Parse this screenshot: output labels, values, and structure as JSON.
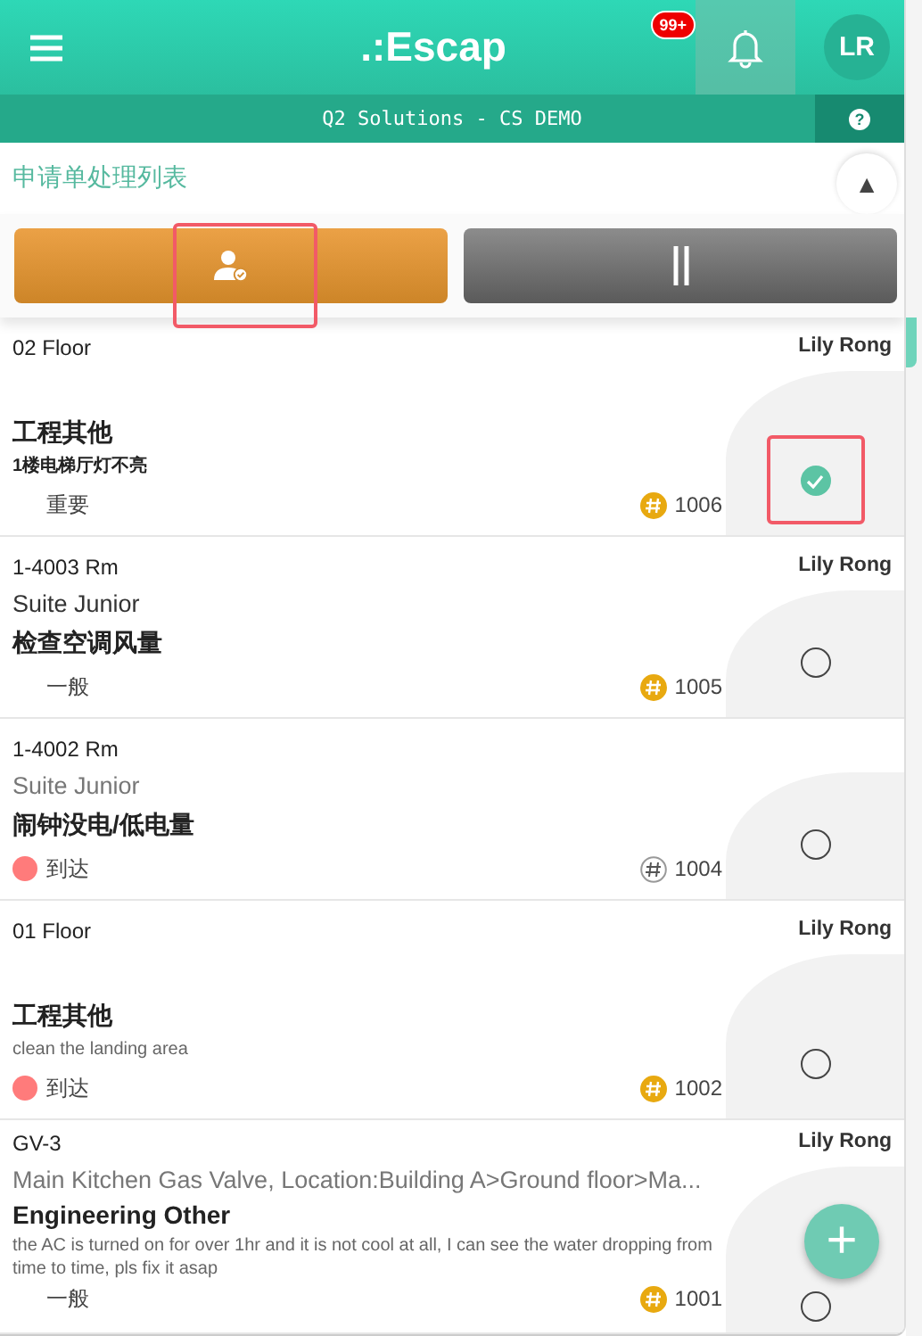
{
  "header": {
    "logo": ".:Escap",
    "badge": "99+",
    "avatar": "LR"
  },
  "subheader": {
    "title": "Q2 Solutions - CS DEMO",
    "help": "?"
  },
  "page_title": "申请单处理列表",
  "collapse": "▲",
  "actions": [
    {
      "kind": "assign",
      "highlighted": true
    },
    {
      "kind": "pause",
      "highlighted": false
    }
  ],
  "rows": [
    {
      "location": "02 Floor",
      "assignee": "Lily Rong",
      "title": "工程其他",
      "description": "1楼电梯厅灯不亮",
      "description_bold": true,
      "status": "重要",
      "number": "1006",
      "number_outlined": false,
      "checked": true,
      "highlighted": true
    },
    {
      "location": "1-4003 Rm",
      "assignee": "Lily Rong",
      "subtitle": "Suite Junior",
      "subtitle_muted": false,
      "title": "检查空调风量",
      "status": "一般",
      "number": "1005",
      "number_outlined": false,
      "checked": false,
      "highlighted": false
    },
    {
      "location": "1-4002 Rm",
      "subtitle": "Suite Junior",
      "subtitle_muted": true,
      "title": "闹钟没电/低电量",
      "status": "到达",
      "color": "#ff7b7b",
      "number": "1004",
      "number_outlined": true,
      "checked": false,
      "highlighted": false
    },
    {
      "location": "01 Floor",
      "assignee": "Lily Rong",
      "title": "工程其他",
      "description": "clean the landing area",
      "description_bold": false,
      "status": "到达",
      "color": "#ff7b7b",
      "number": "1002",
      "number_outlined": false,
      "checked": false,
      "highlighted": false
    },
    {
      "location": "GV-3",
      "assignee": "Lily Rong",
      "subtitle": "Main Kitchen Gas Valve, Location:Building A>Ground floor>Ma...",
      "subtitle_muted": true,
      "title": "Engineering Other",
      "description": "the AC is turned on for over 1hr and it is not cool at all, I can see the water dropping from time to time, pls fix it asap",
      "description_bold": false,
      "status": "一般",
      "number": "1001",
      "number_outlined": false,
      "checked": false,
      "highlighted": false
    }
  ],
  "fab": "+"
}
